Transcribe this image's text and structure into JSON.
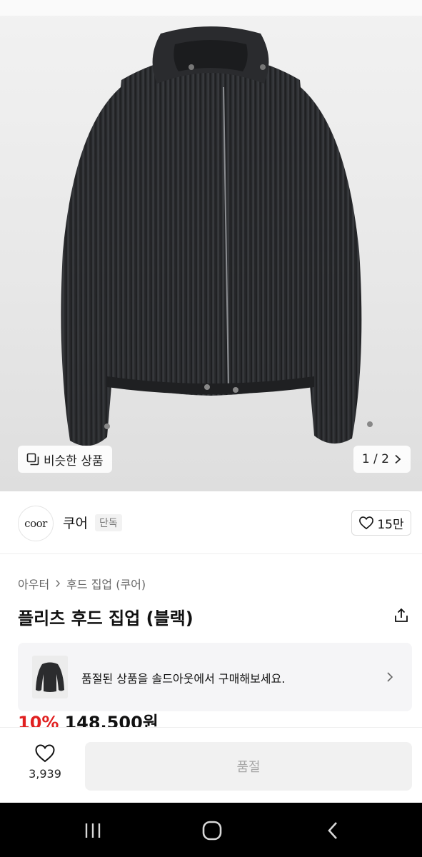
{
  "image": {
    "alt": "",
    "overlay": {
      "similar_label": "비슷한 상품",
      "pager": "1 / 2"
    }
  },
  "brand": {
    "logo_text": "coor",
    "name": "쿠어",
    "badge": "단독",
    "like_count": "15만"
  },
  "breadcrumb": {
    "category": "아우터",
    "subcategory": "후드 집업 (쿠어)"
  },
  "product": {
    "title": "플리츠 후드 집업 (블랙)",
    "soldout_message": "품절된 상품을 솔드아웃에서 구매해보세요.",
    "discount": "10%",
    "price": "148,500원"
  },
  "bottom_bar": {
    "wish_count": "3,939",
    "buy_label": "품절"
  },
  "colors": {
    "discount_red": "#e02020",
    "jacket": "#2b2c2e",
    "disabled_button": "#f1f1f1"
  },
  "icons": {
    "similar": "stacked-squares-icon",
    "pager_next": "chevron-right-icon",
    "brand_like": "heart-outline-icon",
    "share": "share-icon",
    "soldout_next": "chevron-right-icon",
    "wish": "heart-outline-icon",
    "nav_recent": "recent-apps-icon",
    "nav_home": "home-icon",
    "nav_back": "back-icon"
  }
}
